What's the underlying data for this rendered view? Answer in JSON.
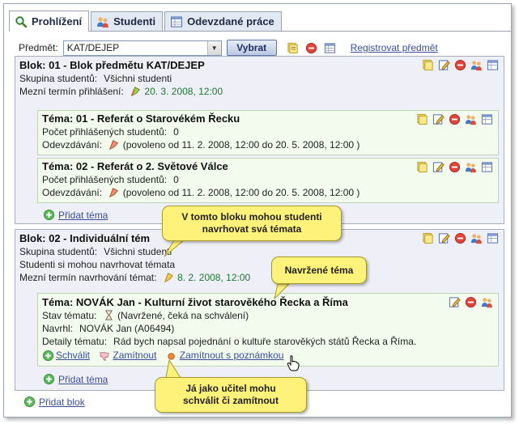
{
  "tabs": [
    {
      "label": "Prohlížení",
      "icon": "magnifier-icon"
    },
    {
      "label": "Studenti",
      "icon": "users-icon"
    },
    {
      "label": "Odevzdané práce",
      "icon": "table-icon"
    }
  ],
  "toolbar": {
    "subject_label": "Předmět:",
    "subject_value": "KAT/DEJEP",
    "select_button": "Vybrat",
    "register_link": "Registrovat předmět"
  },
  "blocks": [
    {
      "title": "Blok: 01 - Blok předmětu KAT/DEJEP",
      "group_label": "Skupina studentů:",
      "group_value": "Všichni studenti",
      "deadline_label": "Mezní termín přihlášení:",
      "deadline_value": "20. 3. 2008, 12:00",
      "topics": [
        {
          "title": "Téma: 01 - Referát o Starovékém Řecku",
          "count_label": "Počet přihlášených studentů:",
          "count_value": "0",
          "submit_label": "Odevzdávání:",
          "submit_value": "(povoleno od 11. 2. 2008, 12:00 do 20. 5. 2008, 12:00 )"
        },
        {
          "title": "Téma: 02 - Referát o 2. Světové Válce",
          "count_label": "Počet přihlášených studentů:",
          "count_value": "0",
          "submit_label": "Odevzdávání:",
          "submit_value": "(povoleno od 11. 2. 2008, 12:00 do 20. 5. 2008, 12:00 )"
        }
      ],
      "add_topic": "Přidat téma"
    },
    {
      "title": "Blok: 02 - Individuální tém",
      "group_label": "Skupina studentů:",
      "group_value": "Všichni studenti",
      "proposal_text": "Studenti si mohou navrhovat témata",
      "deadline_label": "Mezní termín navrhování témat:",
      "deadline_value": "8. 2. 2008, 12:00",
      "topic": {
        "title": "Téma: NOVÁK Jan - Kulturní život starověkého Řecka a Říma",
        "state_label": "Stav tématu:",
        "state_value": "(Navržené, čeká na schválení)",
        "author_label": "Navrhl:",
        "author_value": "NOVÁK Jan (A06494)",
        "details_label": "Detaily tématu:",
        "details_value": "Rád bych napsal pojednání o kultuře starověkých států Řecka a Říma.",
        "approve": "Schválit",
        "reject": "Zamítnout",
        "reject_note": "Zamítnout s poznámkou"
      },
      "add_topic": "Přidat téma"
    }
  ],
  "add_block": "Přidat blok",
  "callouts": {
    "block": "V tomto bloku mohou studenti navrhovat svá témata",
    "proposed": "Navržené téma",
    "teacher": "Já jako učitel mohu schválit či zamítnout"
  }
}
